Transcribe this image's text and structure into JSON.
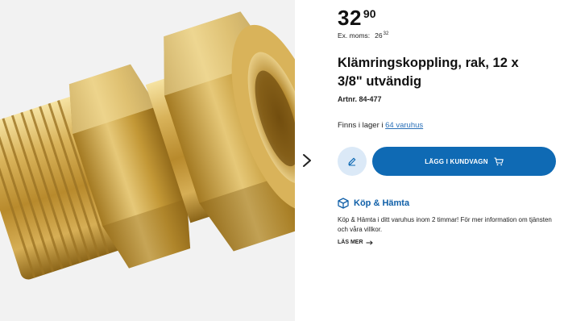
{
  "product": {
    "price_int": "32",
    "price_dec": "90",
    "exvat_label": "Ex. moms:",
    "exvat_int": "26",
    "exvat_dec": "32",
    "title": "Klämringskoppling, rak, 12 x 3/8\" utvändig",
    "artnr": "Artnr. 84-477"
  },
  "stock": {
    "prefix": "Finns i lager i",
    "link": "64 varuhus"
  },
  "actions": {
    "edit_icon": "pencil-icon",
    "cart_label": "LÄGG I KUNDVAGN",
    "cart_icon": "cart-icon"
  },
  "kop_hamta": {
    "icon": "box-icon",
    "title": "Köp & Hämta",
    "text": "Köp & Hämta i ditt varuhus inom 2 timmar! För mer information om tjänsten och våra villkor.",
    "read_more": "LÄS MER"
  },
  "gallery": {
    "next_icon": "chevron-right-icon"
  },
  "colors": {
    "accent": "#0f6ab4",
    "link": "#2a70b8",
    "edit_bg": "#dbe9f7",
    "brass": "#c9a24a"
  }
}
